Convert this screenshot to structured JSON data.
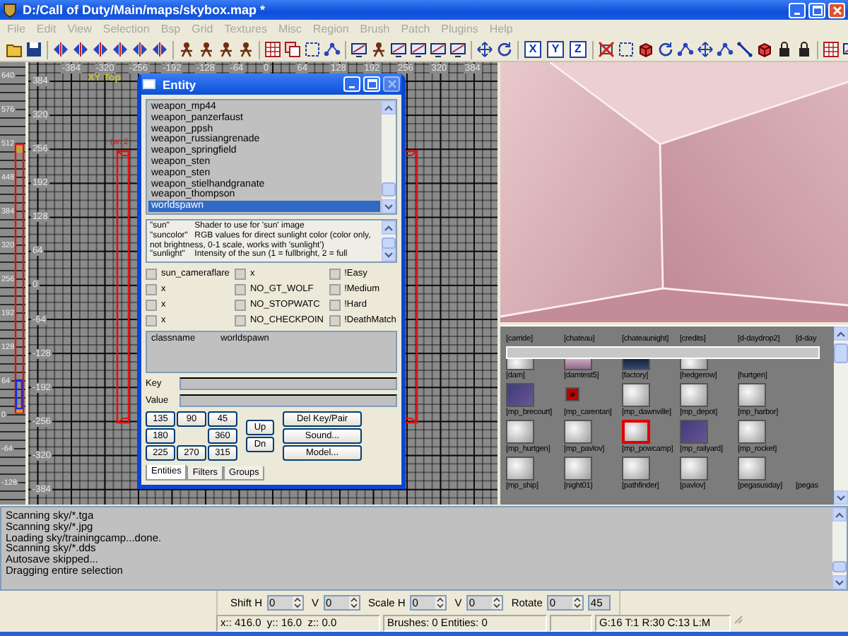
{
  "window": {
    "title": "D:/Call of Duty/Main/maps/skybox.map *"
  },
  "menu": [
    {
      "label": "File",
      "disabled": true
    },
    {
      "label": "Edit",
      "disabled": true
    },
    {
      "label": "View",
      "disabled": true
    },
    {
      "label": "Selection",
      "disabled": true
    },
    {
      "label": "Bsp",
      "disabled": true
    },
    {
      "label": "Grid",
      "disabled": true
    },
    {
      "label": "Textures",
      "disabled": true
    },
    {
      "label": "Misc",
      "disabled": true
    },
    {
      "label": "Region",
      "disabled": true
    },
    {
      "label": "Brush",
      "disabled": true
    },
    {
      "label": "Patch",
      "disabled": true
    },
    {
      "label": "Plugins",
      "disabled": true
    },
    {
      "label": "Help",
      "disabled": true
    }
  ],
  "toolbar": {
    "axis_buttons": [
      "X",
      "Y",
      "Z"
    ]
  },
  "z_view": {
    "ticks": [
      "640",
      "576",
      "512",
      "448",
      "384",
      "320",
      "256",
      "192",
      "128",
      "64",
      "0",
      "-64",
      "-128"
    ]
  },
  "xy_view": {
    "label": "XY Top",
    "brush_label": "(w: 2",
    "x_ticks": [
      "-384",
      "-320",
      "-256",
      "-192",
      "-128",
      "-64",
      "0",
      "64",
      "128",
      "192",
      "256",
      "320",
      "384"
    ],
    "y_ticks": [
      "384",
      "320",
      "256",
      "192",
      "128",
      "64",
      "0",
      "-64",
      "-128",
      "-192",
      "-256",
      "-320",
      "-384"
    ]
  },
  "entity_window": {
    "title": "Entity",
    "classes": [
      {
        "name": "weapon_mp44",
        "selected": false
      },
      {
        "name": "weapon_panzerfaust",
        "selected": false
      },
      {
        "name": "weapon_ppsh",
        "selected": false
      },
      {
        "name": "weapon_russiangrenade",
        "selected": false
      },
      {
        "name": "weapon_springfield",
        "selected": false
      },
      {
        "name": "weapon_sten",
        "selected": false
      },
      {
        "name": "weapon_sten",
        "selected": false
      },
      {
        "name": "weapon_stielhandgranate",
        "selected": false
      },
      {
        "name": "weapon_thompson",
        "selected": false
      },
      {
        "name": "worldspawn",
        "selected": true
      }
    ],
    "descriptions": [
      {
        "key": "\"sun\"",
        "text": "Shader to use for 'sun' image"
      },
      {
        "key": "\"suncolor\"",
        "text": "RGB values for direct sunlight color (color only, not brightness, 0-1 scale, works with 'sunlight')"
      },
      {
        "key": "\"sunlight\"",
        "text": "Intensity of the sun (1 = fullbright, 2 = full"
      }
    ],
    "flags": [
      {
        "label": "sun_cameraflare",
        "checked": false
      },
      {
        "label": "x",
        "checked": false
      },
      {
        "label": "!Easy",
        "checked": false
      },
      {
        "label": "x",
        "checked": false
      },
      {
        "label": "NO_GT_WOLF",
        "checked": false
      },
      {
        "label": "!Medium",
        "checked": false
      },
      {
        "label": "x",
        "checked": false
      },
      {
        "label": "NO_STOPWATC",
        "checked": false
      },
      {
        "label": "!Hard",
        "checked": false
      },
      {
        "label": "x",
        "checked": false
      },
      {
        "label": "NO_CHECKPOIN",
        "checked": false
      },
      {
        "label": "!DeathMatch",
        "checked": false
      }
    ],
    "properties": [
      {
        "key": "classname",
        "value": "worldspawn"
      }
    ],
    "key_label": "Key",
    "value_label": "Value",
    "angle_buttons": [
      "135",
      "90",
      "45",
      "180",
      "360",
      "225",
      "270",
      "315"
    ],
    "move_buttons": [
      "Up",
      "Dn"
    ],
    "action_buttons": [
      "Del Key/Pair",
      "Sound...",
      "Model..."
    ],
    "tabs": [
      {
        "label": "Entities",
        "selected": true
      },
      {
        "label": "Filters",
        "selected": false
      },
      {
        "label": "Groups",
        "selected": false
      }
    ]
  },
  "texture_browser": {
    "rows": [
      {
        "cells": [
          {
            "label": "[carride]",
            "selected": false
          },
          {
            "label": "[chateau]",
            "selected": false
          },
          {
            "label": "[chateaunight]",
            "selected": false
          },
          {
            "label": "[credits]",
            "selected": false
          },
          {
            "label": "[d-daydrop2]",
            "selected": false
          },
          {
            "label": "[d-day",
            "selected": false
          }
        ]
      },
      {
        "cells": [
          {
            "label": "[dam]",
            "kind": "cloud",
            "selected": false
          },
          {
            "label": "[damtest5]",
            "kind": "dusk",
            "selected": false
          },
          {
            "label": "[factory]",
            "kind": "night",
            "selected": false
          },
          {
            "label": "[hedgerow]",
            "kind": "cloud",
            "selected": false
          },
          {
            "label": "[hurtgen]",
            "selected": false
          }
        ]
      },
      {
        "cells": [
          {
            "label": "[mp_brecourt]",
            "kind": "violet",
            "selected": false
          },
          {
            "label": "[mp_carentan]",
            "kind": "red",
            "selected": false
          },
          {
            "label": "[mp_dawnville]",
            "kind": "cloud",
            "selected": false
          },
          {
            "label": "[mp_depot]",
            "kind": "cloud",
            "selected": false
          },
          {
            "label": "[mp_harbor]",
            "kind": "cloud",
            "selected": false
          }
        ]
      },
      {
        "cells": [
          {
            "label": "[mp_hurtgen]",
            "kind": "cloud",
            "selected": false
          },
          {
            "label": "[mp_pavlov]",
            "kind": "cloud",
            "selected": false
          },
          {
            "label": "[mp_powcamp]",
            "kind": "cloud",
            "selected": true
          },
          {
            "label": "[mp_railyard]",
            "kind": "violet",
            "selected": false
          },
          {
            "label": "[mp_rocket]",
            "kind": "cloud",
            "selected": false
          }
        ]
      },
      {
        "cells": [
          {
            "label": "[mp_ship]",
            "kind": "cloud",
            "selected": false
          },
          {
            "label": "[night01]",
            "kind": "cloud",
            "selected": false
          },
          {
            "label": "[pathfinder]",
            "kind": "cloud",
            "selected": false
          },
          {
            "label": "[pavlov]",
            "kind": "cloud",
            "selected": false
          },
          {
            "label": "[pegasusday]",
            "kind": "cloud",
            "selected": false
          },
          {
            "label": "[pegas",
            "selected": false
          }
        ]
      }
    ]
  },
  "console": [
    "Scanning sky/*.tga",
    "Scanning sky/*.jpg",
    "Loading sky/trainingcamp...done.",
    "Scanning sky/*.dds",
    "Autosave skipped...",
    "Dragging entire selection"
  ],
  "surface_inspector": {
    "fields": [
      {
        "label": "Shift H",
        "value": "0"
      },
      {
        "label": "V",
        "value": "0"
      },
      {
        "label": "Scale H",
        "value": "0"
      },
      {
        "label": "V",
        "value": "0"
      },
      {
        "label": "Rotate",
        "value": "0"
      }
    ],
    "rotate_step": "45"
  },
  "status_bar": [
    "x:: 416.0  y:: 16.0  z:: 0.0",
    "Brushes: 0 Entities: 0",
    "G:16 T:1 R:30 C:13 L:M"
  ]
}
